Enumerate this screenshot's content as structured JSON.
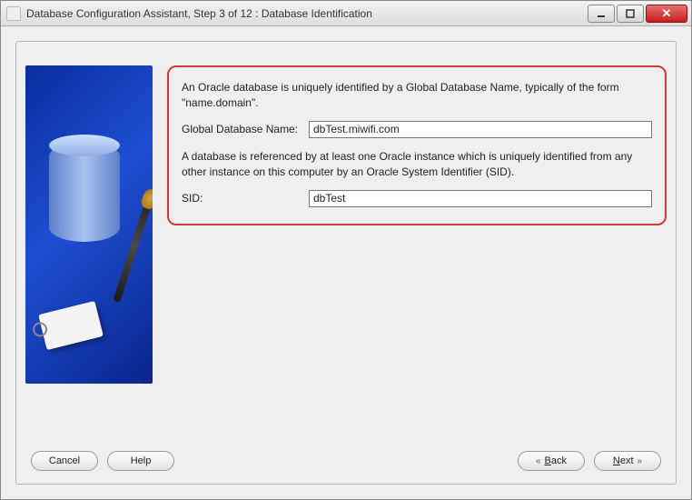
{
  "window": {
    "title": "Database Configuration Assistant, Step 3 of 12 : Database Identification"
  },
  "descriptions": {
    "intro": "An Oracle database is uniquely identified by a Global Database Name, typically of the form \"name.domain\".",
    "sid_info": "A database is referenced by at least one Oracle instance which is uniquely identified from any other instance on this computer by an Oracle System Identifier (SID)."
  },
  "fields": {
    "gdn": {
      "label": "Global Database Name:",
      "value": "dbTest.miwifi.com"
    },
    "sid": {
      "label": "SID:",
      "value": "dbTest"
    }
  },
  "buttons": {
    "cancel": "Cancel",
    "help": "Help",
    "back_prefix": "B",
    "back_rest": "ack",
    "next_prefix": "N",
    "next_rest": "ext"
  }
}
